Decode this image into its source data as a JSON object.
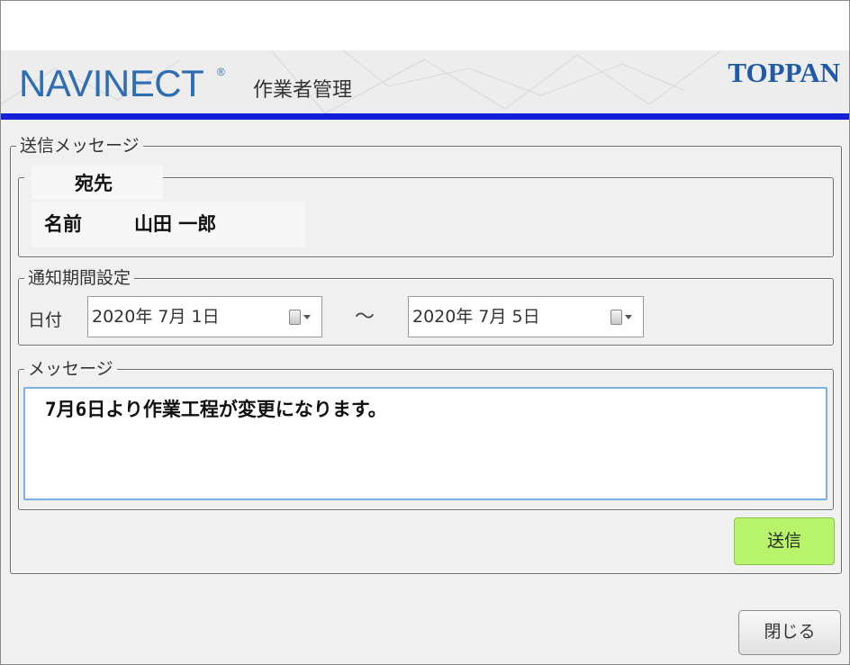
{
  "header": {
    "logo": "NAVINECT",
    "logo_mark": "®",
    "subtitle": "作業者管理",
    "brand": "TOPPAN",
    "accent_color": "#1322d8"
  },
  "send_group": {
    "legend": "送信メッセージ"
  },
  "destination": {
    "tab_label": "宛先",
    "name_label": "名前",
    "name_value": "山田 一郎"
  },
  "period": {
    "legend": "通知期間設定",
    "date_label": "日付",
    "from_date": "2020年  7月  1日",
    "separator": "～",
    "to_date": "2020年  7月  5日",
    "picker_icon": "calendar-dropdown-icon"
  },
  "message": {
    "legend": "メッセージ",
    "text": "7月6日より作業工程が変更になります。"
  },
  "buttons": {
    "send": "送信",
    "send_color": "#b7f46c",
    "close": "閉じる"
  }
}
